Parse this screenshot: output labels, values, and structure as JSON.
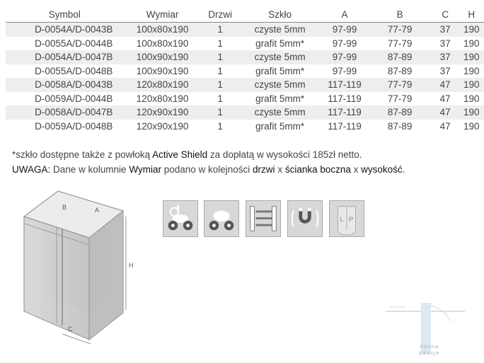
{
  "table": {
    "headers": [
      "Symbol",
      "Wymiar",
      "Drzwi",
      "Szkło",
      "A",
      "B",
      "C",
      "H"
    ],
    "rows": [
      [
        "D-0054A/D-0043B",
        "100x80x190",
        "1",
        "czyste 5mm",
        "97-99",
        "77-79",
        "37",
        "190"
      ],
      [
        "D-0055A/D-0044B",
        "100x80x190",
        "1",
        "grafit 5mm*",
        "97-99",
        "77-79",
        "37",
        "190"
      ],
      [
        "D-0054A/D-0047B",
        "100x90x190",
        "1",
        "czyste 5mm",
        "97-99",
        "87-89",
        "37",
        "190"
      ],
      [
        "D-0055A/D-0048B",
        "100x90x190",
        "1",
        "grafit 5mm*",
        "97-99",
        "87-89",
        "37",
        "190"
      ],
      [
        "D-0058A/D-0043B",
        "120x80x190",
        "1",
        "czyste 5mm",
        "117-119",
        "77-79",
        "47",
        "190"
      ],
      [
        "D-0059A/D-0044B",
        "120x80x190",
        "1",
        "grafit 5mm*",
        "117-119",
        "77-79",
        "47",
        "190"
      ],
      [
        "D-0058A/D-0047B",
        "120x90x190",
        "1",
        "czyste 5mm",
        "117-119",
        "87-89",
        "47",
        "190"
      ],
      [
        "D-0059A/D-0048B",
        "120x90x190",
        "1",
        "grafit 5mm*",
        "117-119",
        "87-89",
        "47",
        "190"
      ]
    ]
  },
  "notes": {
    "line1_a": "*szkło dostępne także z powłoką ",
    "line1_b": "Active Shield",
    "line1_c": " za dopłatą w wysokości 185zł netto.",
    "line2_a": "UWAGA:",
    "line2_b": " Dane w kolumnie ",
    "line2_c": "Wymiar",
    "line2_d": " podano w kolejności ",
    "line2_e": "drzwi",
    "line2_f": " x ",
    "line2_g": "ścianka boczna",
    "line2_h": " x ",
    "line2_i": "wysokość",
    "line2_j": "."
  },
  "drawing": {
    "label_a": "A",
    "label_b": "B",
    "label_c": "C",
    "label_h": "H"
  },
  "feature_icons": [
    "rollers-top-icon",
    "rollers-bottom-icon",
    "sliding-door-icon",
    "magnetic-seal-icon",
    "left-right-reversible-icon"
  ],
  "feature_icon_labels": {
    "l": "L",
    "p": "P"
  },
  "logo": {
    "line1": "Venna",
    "line2": "pasuje"
  }
}
